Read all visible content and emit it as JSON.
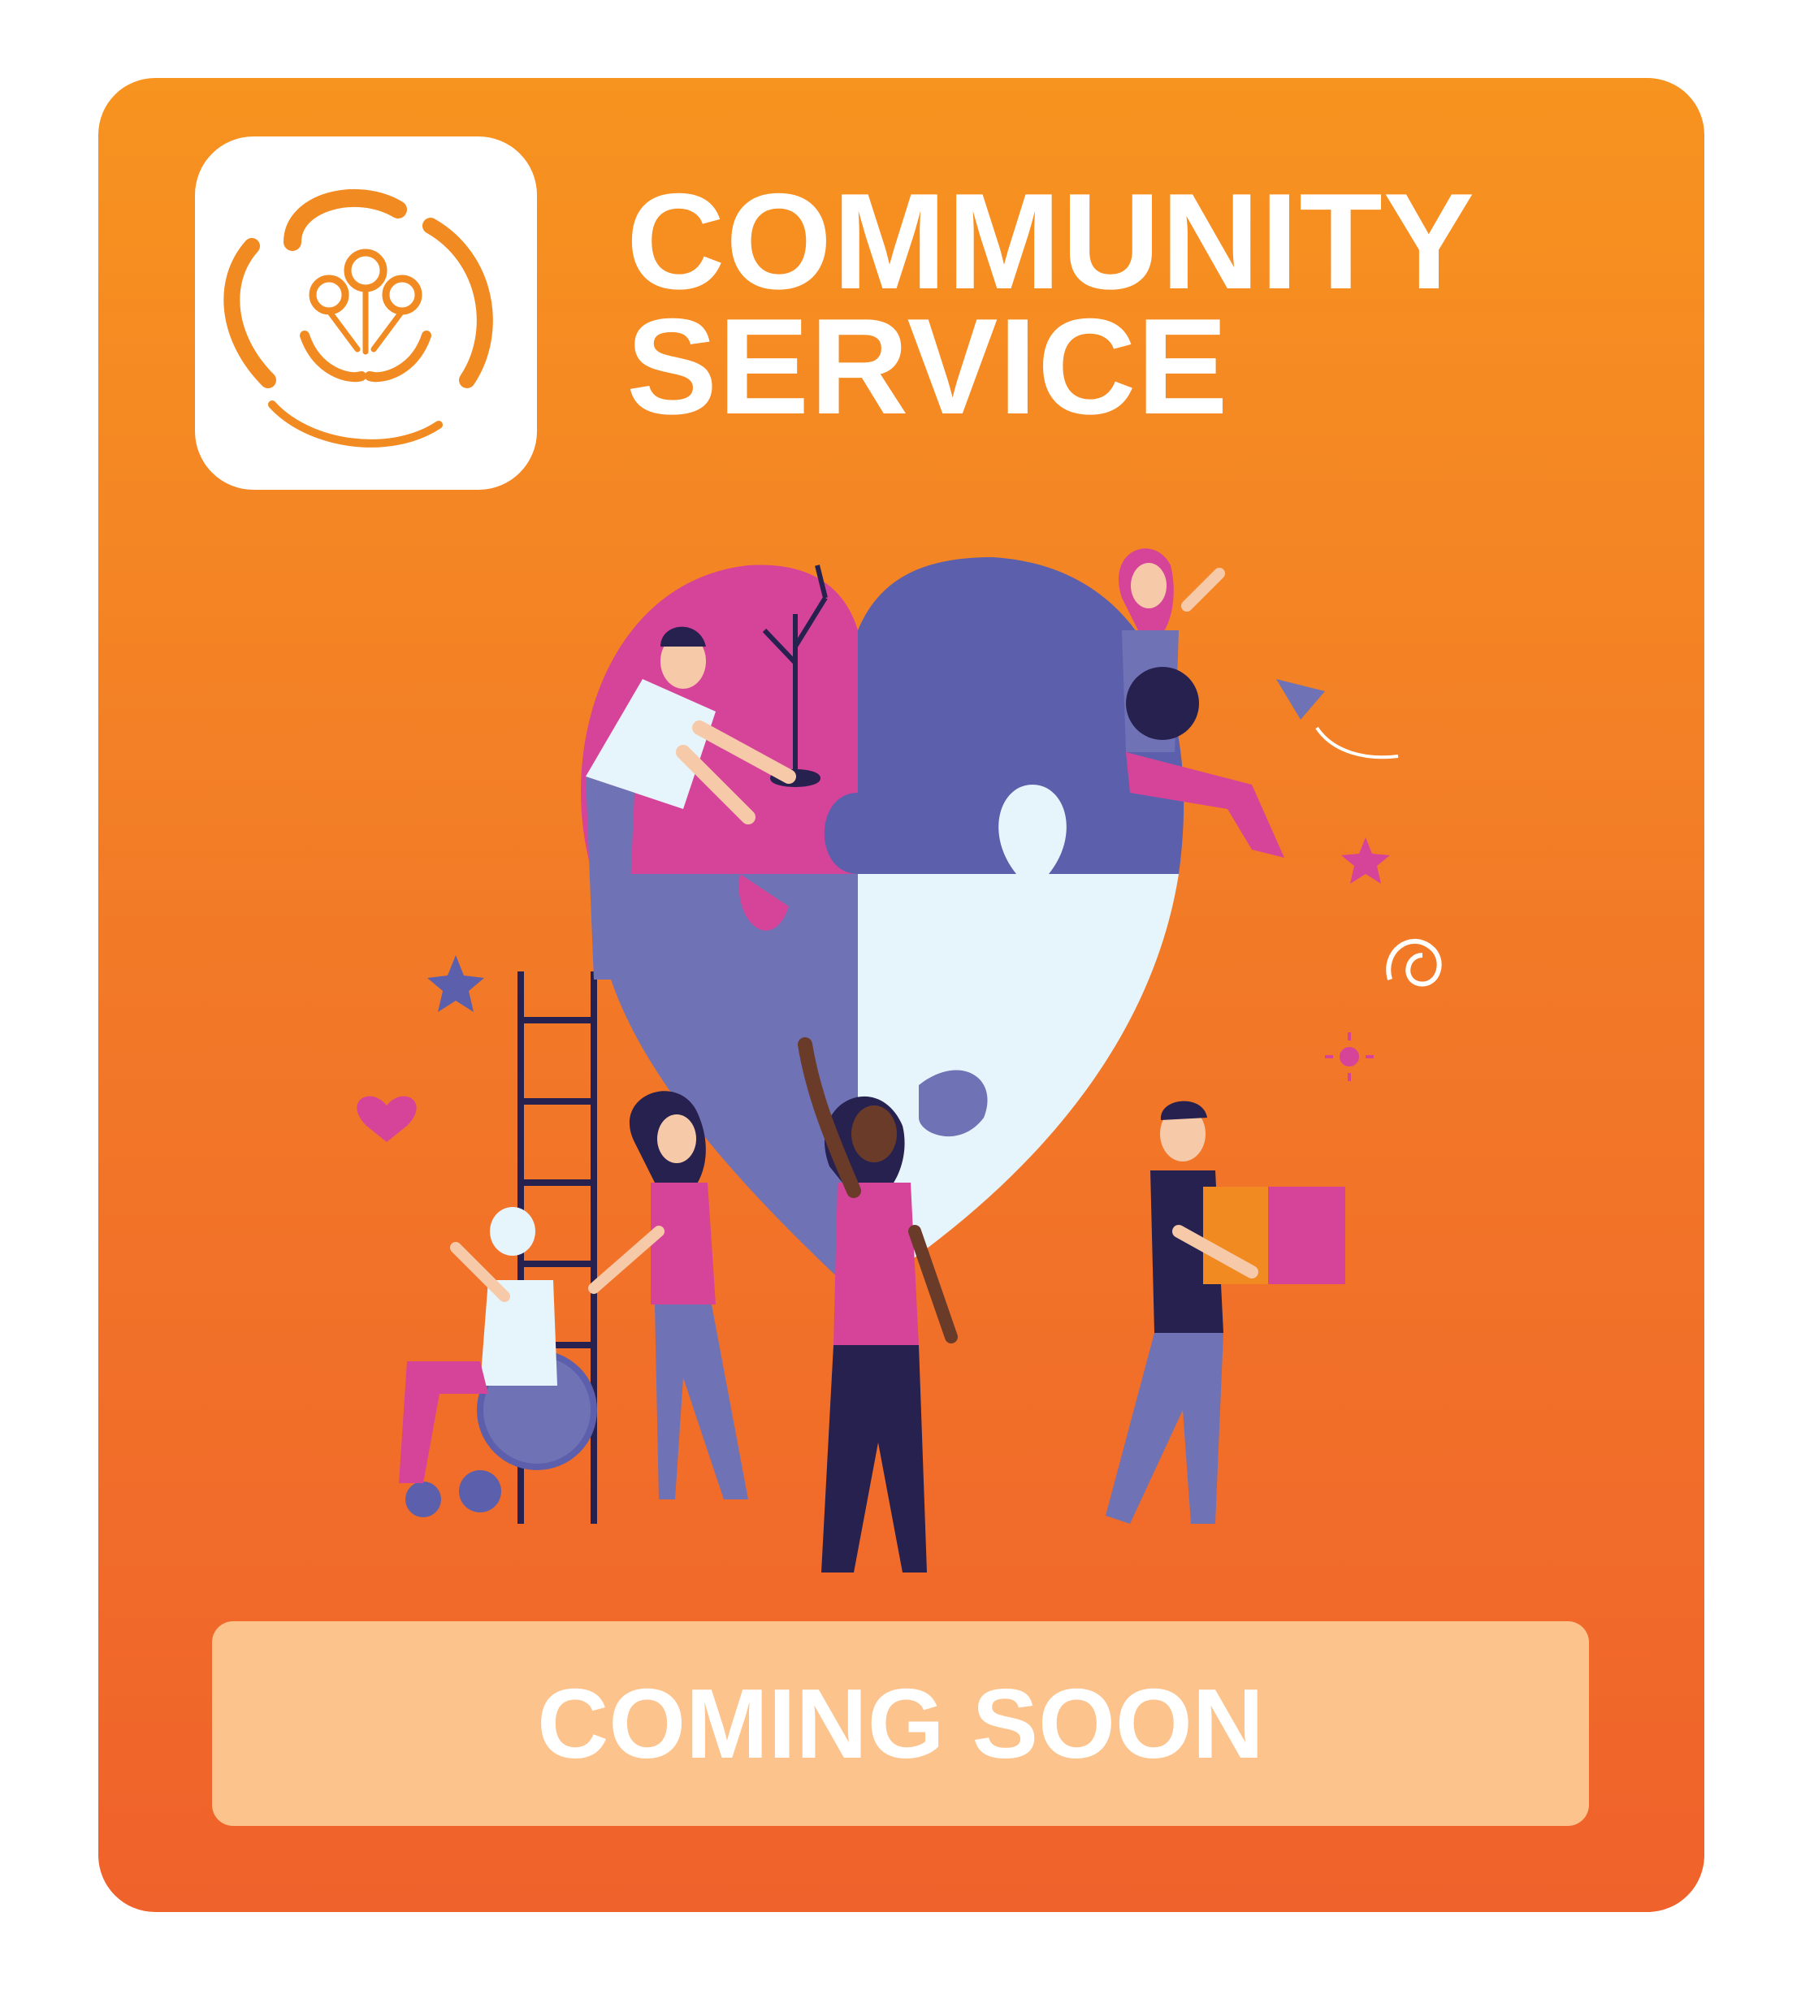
{
  "header": {
    "logo_icon": "community-hands-icon",
    "title_line1": "COMMUNITY",
    "title_line2": "SERVICE"
  },
  "illustration": {
    "icons": [
      "puzzle-heart-icon",
      "person-planting-tree-icon",
      "woman-with-dog-icon",
      "paper-plane-icon",
      "person-in-wheelchair-icon",
      "woman-waving-icon",
      "man-carrying-box-icon",
      "ladder-icon",
      "star-icon",
      "heart-icon"
    ]
  },
  "cta": {
    "label": "COMING SOON"
  },
  "colors": {
    "card_top": "#f7931f",
    "card_bottom": "#f0622b",
    "cta_background": "#fcc38c",
    "pink": "#d6449a",
    "purple": "#5c5fab",
    "light_purple": "#6f72b5",
    "pale_blue": "#e6f4fb",
    "navy": "#27214f"
  }
}
